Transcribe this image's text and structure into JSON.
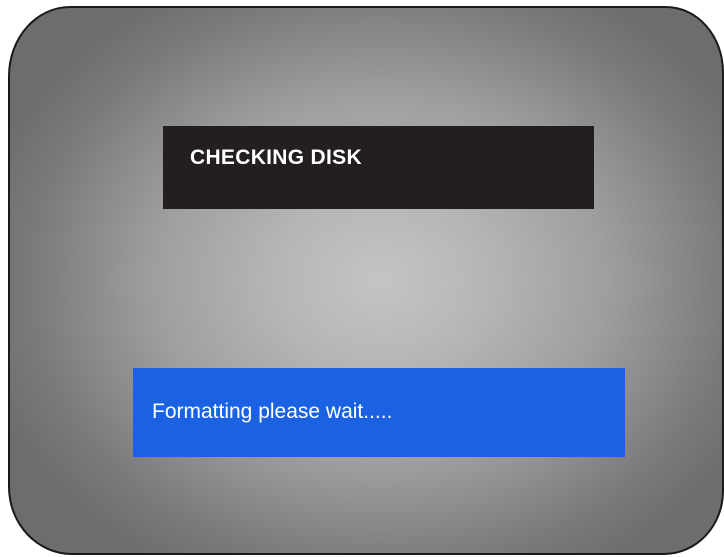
{
  "dialog": {
    "title": "CHECKING DISK",
    "status_message": "Formatting please wait....."
  },
  "colors": {
    "title_panel_bg": "#231f20",
    "status_panel_bg": "#1b62e3",
    "text": "#ffffff",
    "screen_center": "#c4c4c4",
    "screen_edge": "#6d6d6d"
  }
}
